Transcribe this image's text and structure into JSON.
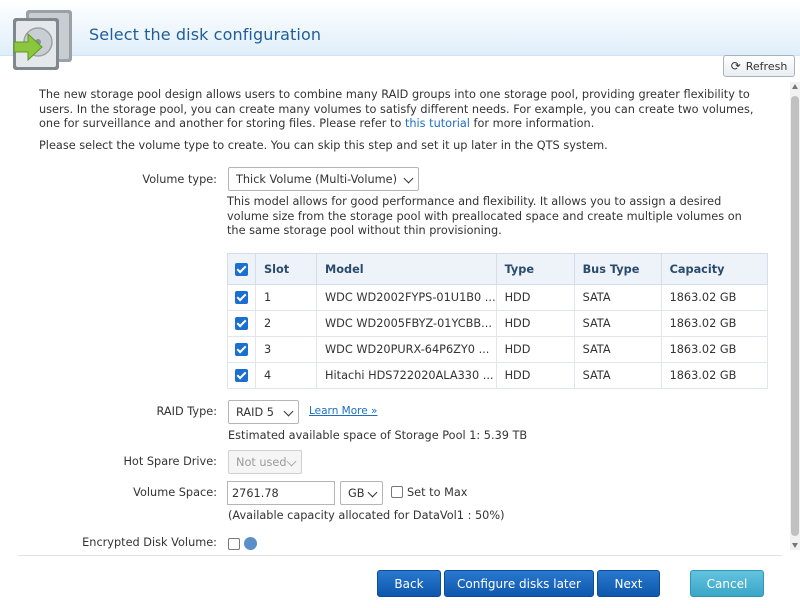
{
  "header": {
    "title": "Select the disk configuration",
    "icon": "disk-arrow-icon"
  },
  "toolbar": {
    "refresh_label": "Refresh",
    "refresh_icon": "refresh-icon"
  },
  "intro": {
    "line1": "The new storage pool design allows users to combine many RAID groups into one storage pool, providing greater flexibility to users. In the storage pool, you can create many volumes to satisfy different needs. For example, you can create two volumes, one for surveillance and another for storing files. Please refer to ",
    "link": "this tutorial",
    "line2": " for more information.",
    "select_prompt": "Please select the volume type to create. You can skip this step and set it up later in the QTS system."
  },
  "volume_type": {
    "label": "Volume type:",
    "value": "Thick Volume (Multi-Volume)",
    "description": "This model allows for good performance and flexibility. It allows you to assign a desired volume size from the storage pool with preallocated space and create multiple volumes on the same storage pool without thin provisioning."
  },
  "disk_table": {
    "columns": [
      "Slot",
      "Model",
      "Type",
      "Bus Type",
      "Capacity"
    ],
    "rows": [
      {
        "slot": "1",
        "model": "WDC WD2002FYPS-01U1B0 ...",
        "type": "HDD",
        "bus": "SATA",
        "capacity": "1863.02 GB",
        "checked": true
      },
      {
        "slot": "2",
        "model": "WDC WD2005FBYZ-01YCBB...",
        "type": "HDD",
        "bus": "SATA",
        "capacity": "1863.02 GB",
        "checked": true
      },
      {
        "slot": "3",
        "model": "WDC WD20PURX-64P6ZY0 ...",
        "type": "HDD",
        "bus": "SATA",
        "capacity": "1863.02 GB",
        "checked": true
      },
      {
        "slot": "4",
        "model": "Hitachi HDS722020ALA330 ...",
        "type": "HDD",
        "bus": "SATA",
        "capacity": "1863.02 GB",
        "checked": true
      }
    ]
  },
  "raid": {
    "label": "RAID Type:",
    "value": "RAID 5",
    "learn_more": "Learn More »",
    "estimate": "Estimated available space of Storage Pool 1: 5.39 TB"
  },
  "hot_spare": {
    "label": "Hot Spare Drive:",
    "value": "Not used"
  },
  "volume_space": {
    "label": "Volume Space:",
    "value": "2761.78",
    "unit": "GB",
    "set_to_max": "Set to Max",
    "note": "(Available capacity allocated for DataVol1 : 50%)"
  },
  "encrypted": {
    "label": "Encrypted Disk Volume:"
  },
  "footer": {
    "back": "Back",
    "configure_later": "Configure disks later",
    "next": "Next",
    "cancel": "Cancel"
  },
  "colors": {
    "accent": "#0d58ad",
    "title": "#1f5e97",
    "cancel": "#3aa6c8",
    "link": "#1b6fc2"
  }
}
